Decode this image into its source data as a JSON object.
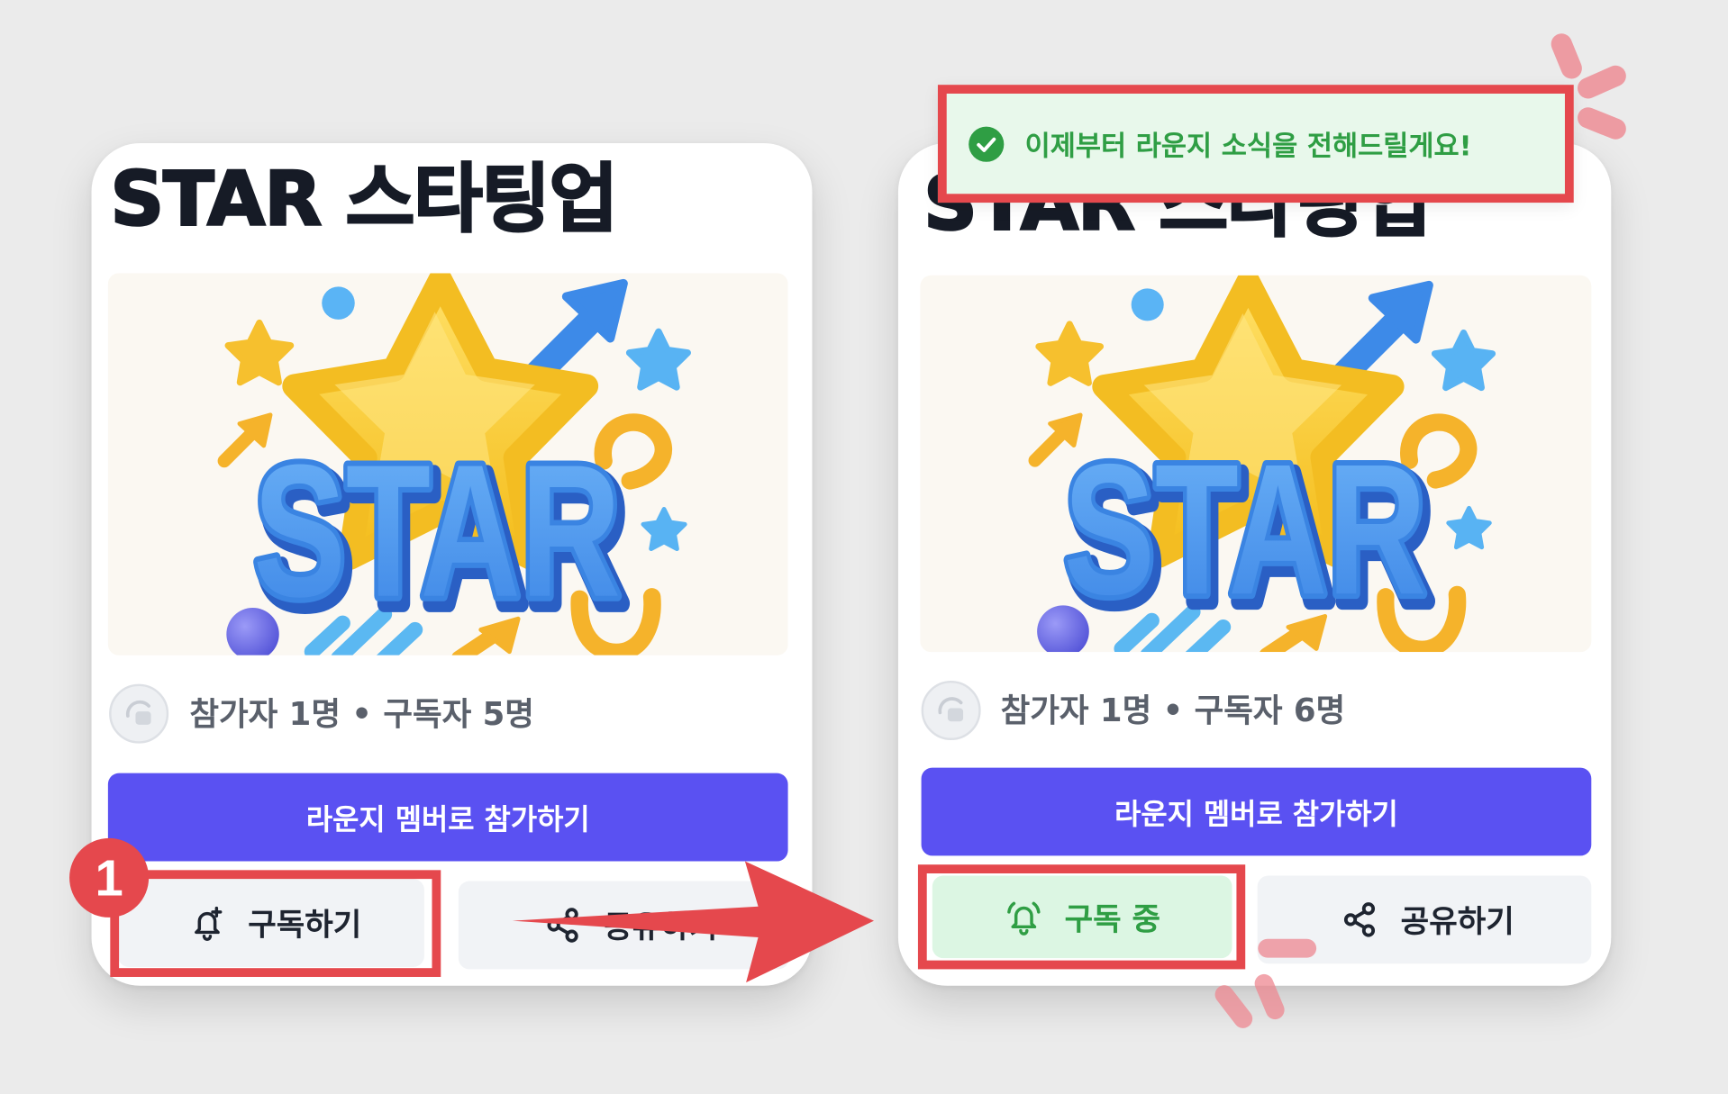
{
  "cards": {
    "before": {
      "title": "STAR 스타팅업",
      "stats": "참가자 1명 • 구독자 5명",
      "join_label": "라운지 멤버로 참가하기",
      "subscribe_label": "구독하기",
      "share_label": "공유하기"
    },
    "after": {
      "title": "STAR 스타팅업",
      "stats": "참가자 1명 • 구독자 6명",
      "join_label": "라운지 멤버로 참가하기",
      "subscribed_label": "구독 중",
      "share_label": "공유하기"
    }
  },
  "illustration": {
    "lettering": "STAR"
  },
  "toast": {
    "message": "이제부터 라운지 소식을 전해드릴게요!"
  },
  "annotations": {
    "step_badge": "1"
  },
  "icons": {
    "subscribe": "bell-plus-icon",
    "subscribed": "bell-ringing-icon",
    "share": "share-icon",
    "toast": "check-circle-icon",
    "avatar": "avatar-icon"
  },
  "colors": {
    "page_bg": "#ebebeb",
    "join_button": "#5a51f2",
    "subscribed_bg": "#dcf6e3",
    "subscribed_text": "#2f9e44",
    "toast_bg": "#e8f8eb",
    "annotation_red": "#e5484d"
  }
}
